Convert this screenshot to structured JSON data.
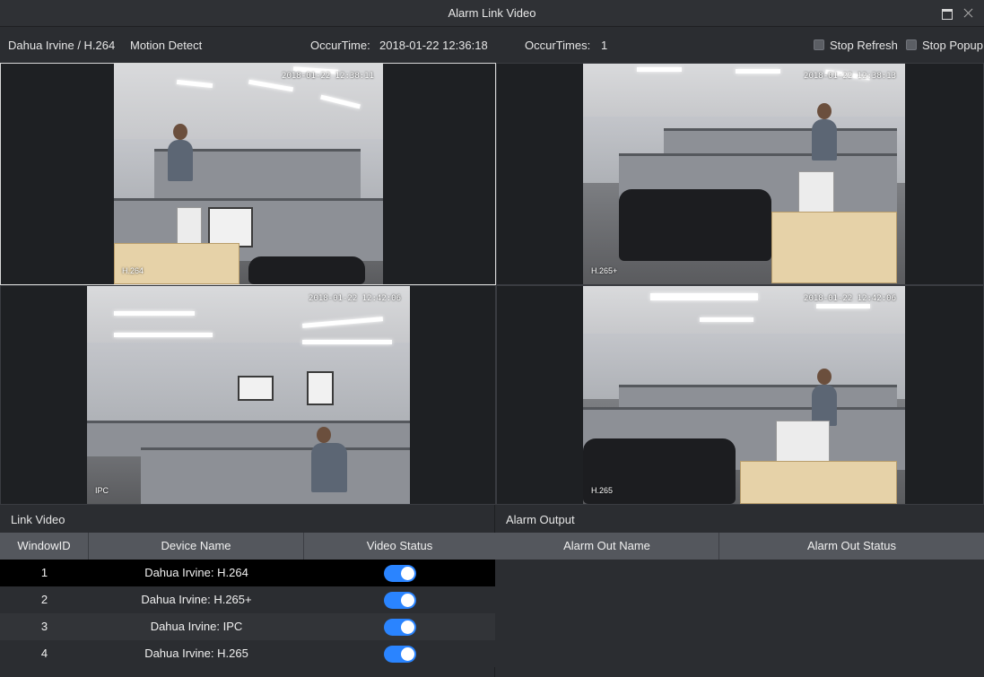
{
  "window": {
    "title": "Alarm Link Video"
  },
  "info": {
    "device": "Dahua Irvine / H.264",
    "event": "Motion Detect",
    "occur_time_label": "OccurTime:",
    "occur_time_value": "2018-01-22  12:36:18",
    "occur_times_label": "OccurTimes:",
    "occur_times_value": "1",
    "stop_refresh": "Stop Refresh",
    "stop_popup": "Stop Popup"
  },
  "videos": [
    {
      "timestamp": "2018-01-22 12:38:11",
      "codec": "H.264"
    },
    {
      "timestamp": "2018-01-22 12:38:13",
      "codec": "H.265+"
    },
    {
      "timestamp": "2018-01-22 12:42:06",
      "codec": "IPC"
    },
    {
      "timestamp": "2018-01-22 12:42:06",
      "codec": "H.265"
    }
  ],
  "link_video": {
    "title": "Link Video",
    "columns": [
      "WindowID",
      "Device Name",
      "Video Status"
    ],
    "rows": [
      {
        "id": "1",
        "name": "Dahua Irvine: H.264",
        "status": "on"
      },
      {
        "id": "2",
        "name": "Dahua Irvine: H.265+",
        "status": "on"
      },
      {
        "id": "3",
        "name": "Dahua Irvine: IPC",
        "status": "on"
      },
      {
        "id": "4",
        "name": "Dahua Irvine: H.265",
        "status": "on"
      }
    ]
  },
  "alarm_output": {
    "title": "Alarm Output",
    "columns": [
      "Alarm Out Name",
      "Alarm Out Status"
    ]
  },
  "colors": {
    "accent": "#2a84ff",
    "selected_row": "#000000",
    "header_bg": "#54575d"
  }
}
